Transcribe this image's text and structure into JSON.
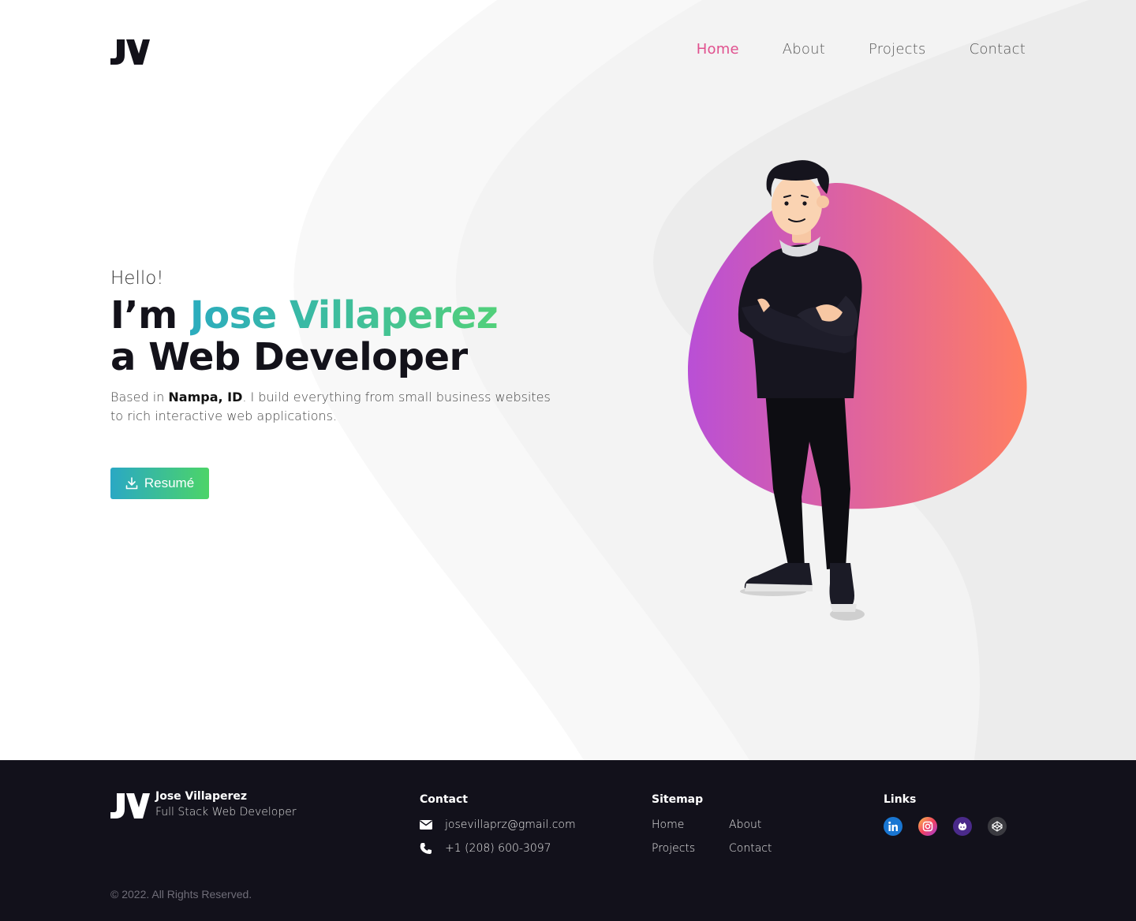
{
  "header": {
    "logo_text": "JV",
    "nav": [
      {
        "label": "Home",
        "active": true
      },
      {
        "label": "About",
        "active": false
      },
      {
        "label": "Projects",
        "active": false
      },
      {
        "label": "Contact",
        "active": false
      }
    ]
  },
  "hero": {
    "greeting": "Hello!",
    "headline_prefix": "I’m ",
    "name": "Jose Villaperez",
    "headline_line2": "a Web Developer",
    "desc_prefix": "Based in ",
    "desc_location": "Nampa, ID",
    "desc_suffix": ". I build everything from small business websites to rich interactive web applications.",
    "resume_label": "Resumé"
  },
  "footer": {
    "name": "Jose Villaperez",
    "role": "Full Stack Web Developer",
    "contact_heading": "Contact",
    "email": "josevillaprz@gmail.com",
    "phone": "+1 (208) 600-3097",
    "sitemap_heading": "Sitemap",
    "sitemap": [
      "Home",
      "About",
      "Projects",
      "Contact"
    ],
    "links_heading": "Links",
    "social_icons": [
      "linkedin-icon",
      "instagram-icon",
      "github-icon",
      "codepen-icon"
    ],
    "copyright": "© 2022. All Rights Reserved."
  },
  "colors": {
    "accent_pink": "#e0508e",
    "name_gradient": [
      "#2bacbe",
      "#52d07a"
    ],
    "button_gradient": [
      "#2aa8c4",
      "#4cd468"
    ],
    "blob_gradient": [
      "#b94fd6",
      "#ff7e62"
    ],
    "footer_bg": "#12111b"
  }
}
